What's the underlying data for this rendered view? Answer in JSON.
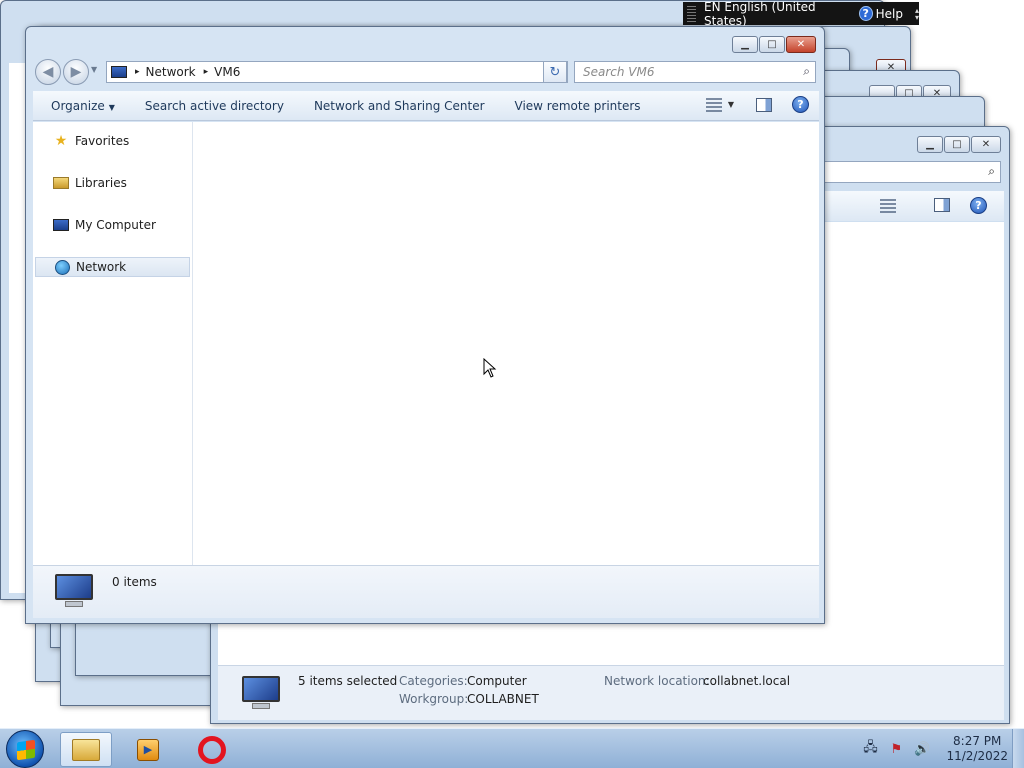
{
  "language_bar": {
    "language": "EN English (United States)",
    "help_label": "Help",
    "help_glyph": "?"
  },
  "main_window": {
    "nav": {
      "back_glyph": "◀",
      "forward_glyph": "▶"
    },
    "address": {
      "crumbs": [
        "Network",
        "VM6"
      ],
      "separator": "▸"
    },
    "search": {
      "placeholder": "Search VM6"
    },
    "toolbar": {
      "organize": "Organize",
      "search_ad": "Search active directory",
      "network_sharing": "Network and Sharing Center",
      "remote_printers": "View remote printers"
    },
    "nav_pane": {
      "favorites": "Favorites",
      "libraries": "Libraries",
      "my_computer": "My Computer",
      "network": "Network"
    },
    "status": {
      "count": "0 items"
    }
  },
  "back_window": {
    "selected": "5 items selected",
    "categories_label": "Categories:",
    "categories_value": "Computer",
    "workgroup_label": "Workgroup:",
    "workgroup_value": "COLLABNET",
    "network_location_label": "Network location:",
    "network_location_value": "collabnet.local"
  },
  "taskbar": {
    "time": "8:27 PM",
    "date": "11/2/2022"
  },
  "icons": [
    "start-orb-icon",
    "explorer-folder-icon",
    "media-player-icon",
    "opera-icon",
    "network-tray-icon",
    "action-center-icon",
    "volume-icon"
  ]
}
